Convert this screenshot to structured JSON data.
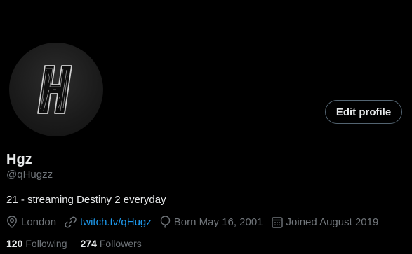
{
  "profile": {
    "display_name": "Hgz",
    "handle": "@qHugzz",
    "bio": "21 - streaming Destiny 2 everyday",
    "edit_button_label": "Edit profile",
    "avatar_icon": "h-letter-logo"
  },
  "meta": {
    "location": "London",
    "location_icon": "location-pin-icon",
    "website": "twitch.tv/qHugz",
    "website_icon": "link-icon",
    "birthday": "Born May 16, 2001",
    "birthday_icon": "balloon-icon",
    "joined": "Joined August 2019",
    "joined_icon": "calendar-icon"
  },
  "stats": {
    "following_count": "120",
    "following_label": "Following",
    "followers_count": "274",
    "followers_label": "Followers"
  },
  "colors": {
    "background": "#000000",
    "text_primary": "#e7e9ea",
    "text_secondary": "#71767b",
    "link": "#1d9bf0",
    "button_border": "#536471"
  }
}
